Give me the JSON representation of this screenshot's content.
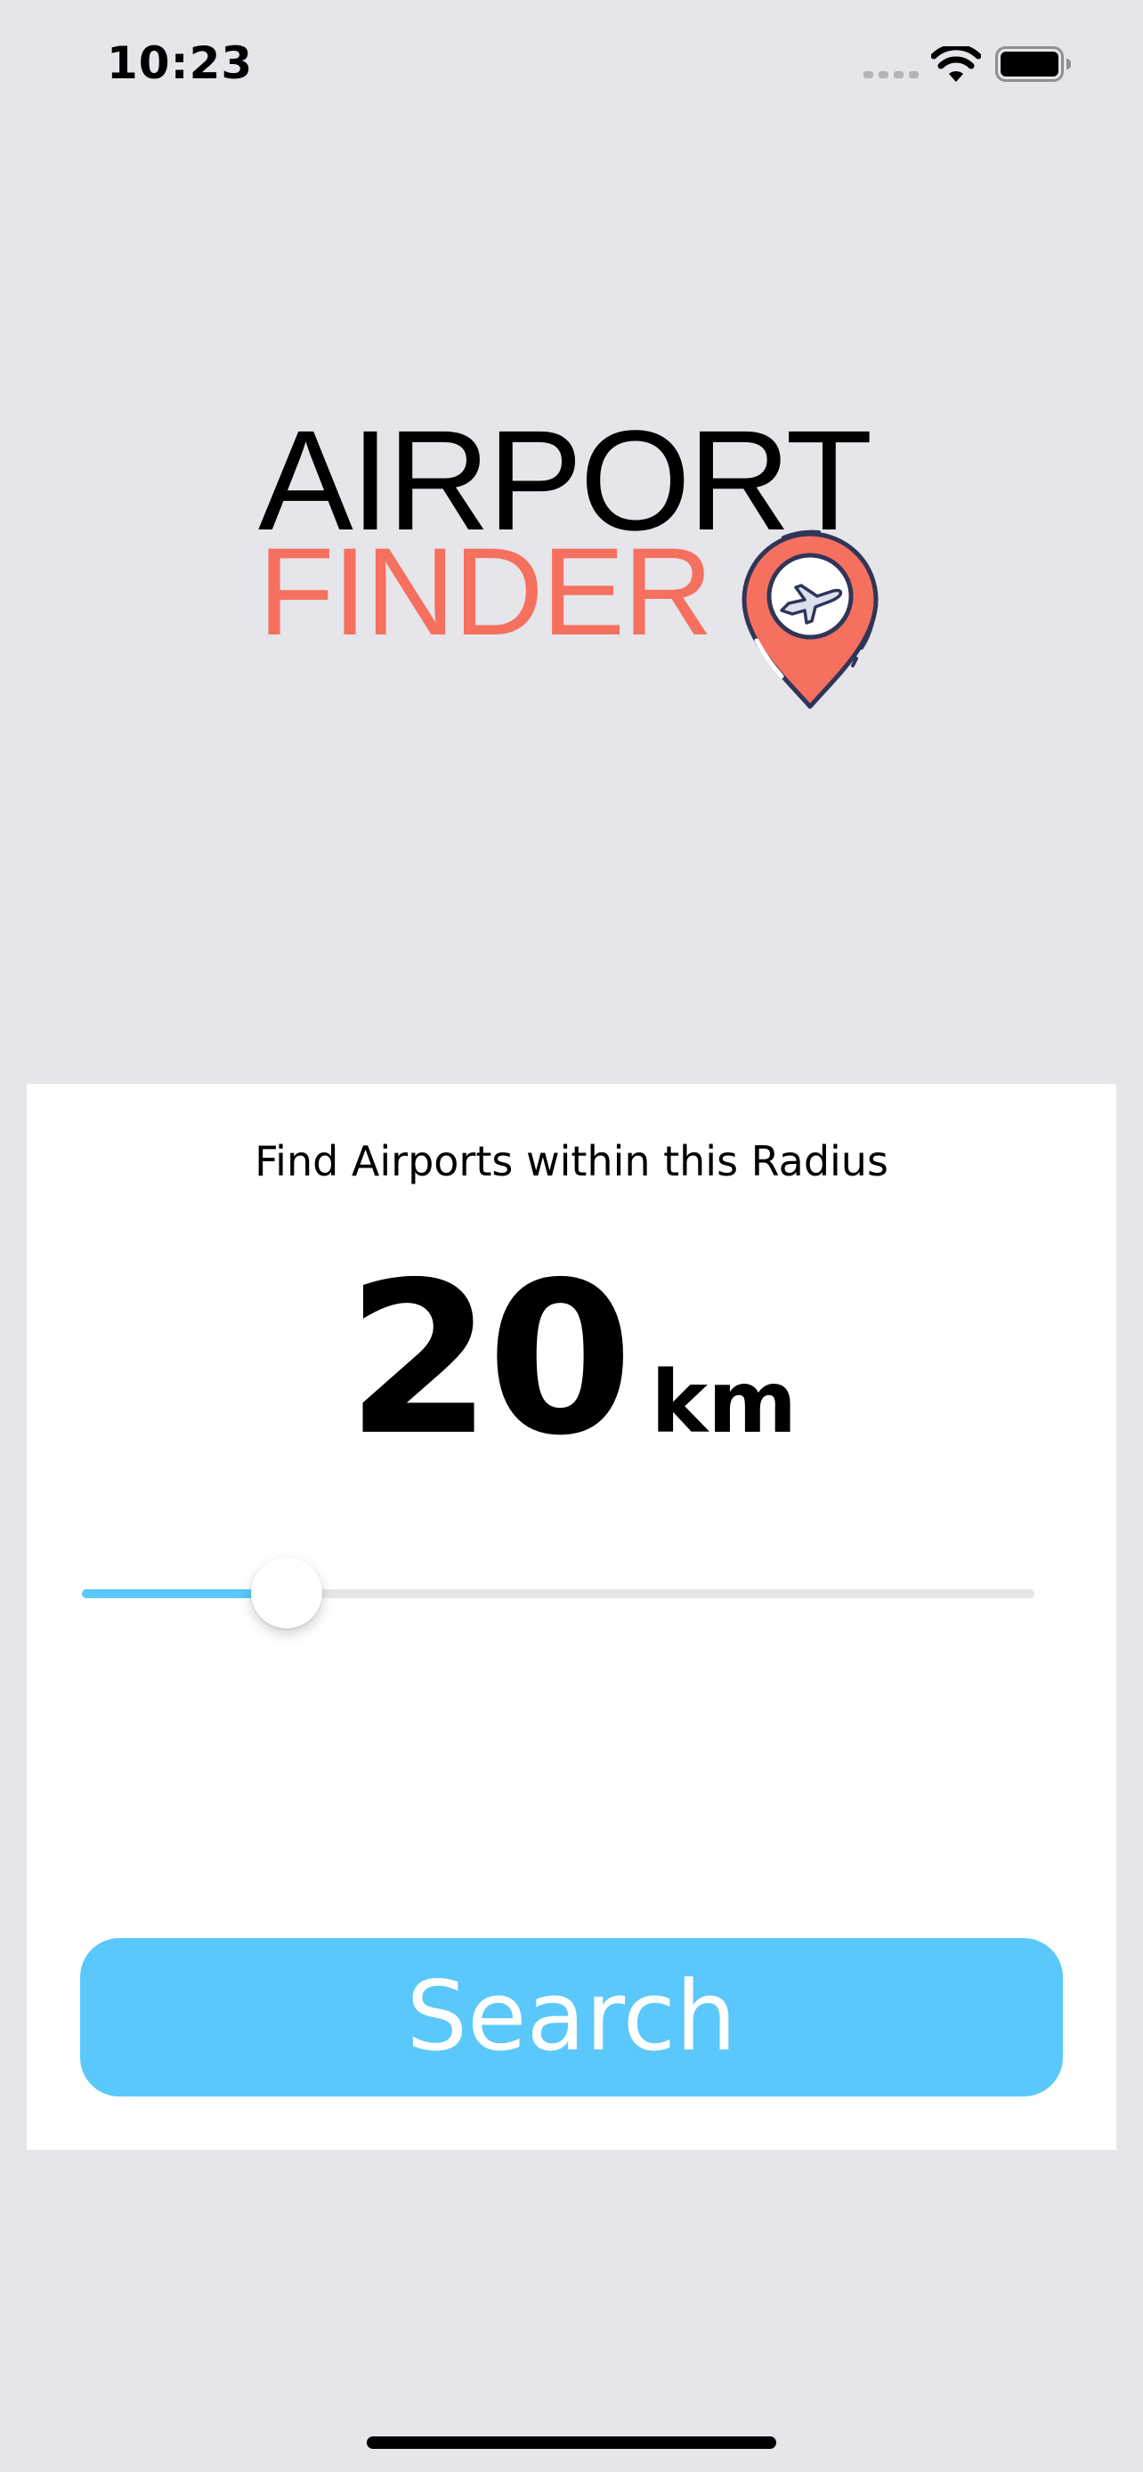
{
  "status_bar": {
    "time": "10:23"
  },
  "logo": {
    "line1": "AIRPORT",
    "line2": "FINDER",
    "accent_color": "#f5705e",
    "icon": "location-pin-airplane-icon"
  },
  "radius_card": {
    "title": "Find Airports within this Radius",
    "value": "20",
    "unit": "km",
    "slider": {
      "fraction": 0.215,
      "accent_color": "#5ac8fa"
    },
    "search_label": "Search"
  }
}
